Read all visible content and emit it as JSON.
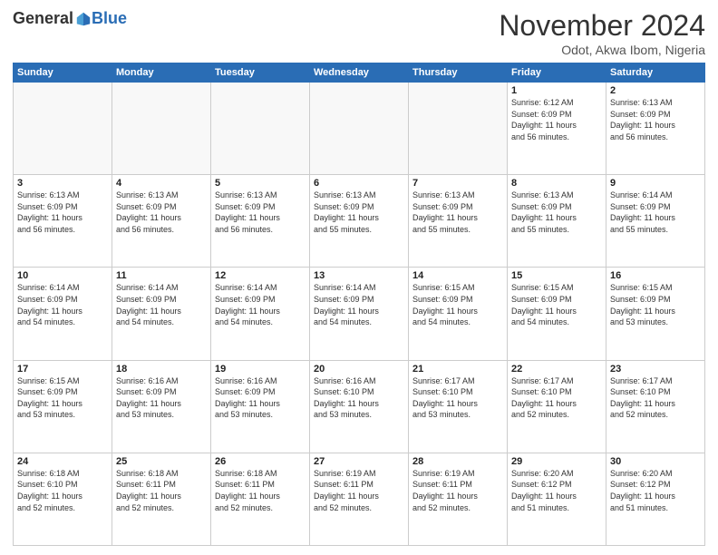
{
  "header": {
    "logo_general": "General",
    "logo_blue": "Blue",
    "month_title": "November 2024",
    "location": "Odot, Akwa Ibom, Nigeria"
  },
  "calendar": {
    "days_of_week": [
      "Sunday",
      "Monday",
      "Tuesday",
      "Wednesday",
      "Thursday",
      "Friday",
      "Saturday"
    ],
    "weeks": [
      [
        {
          "day": "",
          "info": ""
        },
        {
          "day": "",
          "info": ""
        },
        {
          "day": "",
          "info": ""
        },
        {
          "day": "",
          "info": ""
        },
        {
          "day": "",
          "info": ""
        },
        {
          "day": "1",
          "info": "Sunrise: 6:12 AM\nSunset: 6:09 PM\nDaylight: 11 hours\nand 56 minutes."
        },
        {
          "day": "2",
          "info": "Sunrise: 6:13 AM\nSunset: 6:09 PM\nDaylight: 11 hours\nand 56 minutes."
        }
      ],
      [
        {
          "day": "3",
          "info": "Sunrise: 6:13 AM\nSunset: 6:09 PM\nDaylight: 11 hours\nand 56 minutes."
        },
        {
          "day": "4",
          "info": "Sunrise: 6:13 AM\nSunset: 6:09 PM\nDaylight: 11 hours\nand 56 minutes."
        },
        {
          "day": "5",
          "info": "Sunrise: 6:13 AM\nSunset: 6:09 PM\nDaylight: 11 hours\nand 56 minutes."
        },
        {
          "day": "6",
          "info": "Sunrise: 6:13 AM\nSunset: 6:09 PM\nDaylight: 11 hours\nand 55 minutes."
        },
        {
          "day": "7",
          "info": "Sunrise: 6:13 AM\nSunset: 6:09 PM\nDaylight: 11 hours\nand 55 minutes."
        },
        {
          "day": "8",
          "info": "Sunrise: 6:13 AM\nSunset: 6:09 PM\nDaylight: 11 hours\nand 55 minutes."
        },
        {
          "day": "9",
          "info": "Sunrise: 6:14 AM\nSunset: 6:09 PM\nDaylight: 11 hours\nand 55 minutes."
        }
      ],
      [
        {
          "day": "10",
          "info": "Sunrise: 6:14 AM\nSunset: 6:09 PM\nDaylight: 11 hours\nand 54 minutes."
        },
        {
          "day": "11",
          "info": "Sunrise: 6:14 AM\nSunset: 6:09 PM\nDaylight: 11 hours\nand 54 minutes."
        },
        {
          "day": "12",
          "info": "Sunrise: 6:14 AM\nSunset: 6:09 PM\nDaylight: 11 hours\nand 54 minutes."
        },
        {
          "day": "13",
          "info": "Sunrise: 6:14 AM\nSunset: 6:09 PM\nDaylight: 11 hours\nand 54 minutes."
        },
        {
          "day": "14",
          "info": "Sunrise: 6:15 AM\nSunset: 6:09 PM\nDaylight: 11 hours\nand 54 minutes."
        },
        {
          "day": "15",
          "info": "Sunrise: 6:15 AM\nSunset: 6:09 PM\nDaylight: 11 hours\nand 54 minutes."
        },
        {
          "day": "16",
          "info": "Sunrise: 6:15 AM\nSunset: 6:09 PM\nDaylight: 11 hours\nand 53 minutes."
        }
      ],
      [
        {
          "day": "17",
          "info": "Sunrise: 6:15 AM\nSunset: 6:09 PM\nDaylight: 11 hours\nand 53 minutes."
        },
        {
          "day": "18",
          "info": "Sunrise: 6:16 AM\nSunset: 6:09 PM\nDaylight: 11 hours\nand 53 minutes."
        },
        {
          "day": "19",
          "info": "Sunrise: 6:16 AM\nSunset: 6:09 PM\nDaylight: 11 hours\nand 53 minutes."
        },
        {
          "day": "20",
          "info": "Sunrise: 6:16 AM\nSunset: 6:10 PM\nDaylight: 11 hours\nand 53 minutes."
        },
        {
          "day": "21",
          "info": "Sunrise: 6:17 AM\nSunset: 6:10 PM\nDaylight: 11 hours\nand 53 minutes."
        },
        {
          "day": "22",
          "info": "Sunrise: 6:17 AM\nSunset: 6:10 PM\nDaylight: 11 hours\nand 52 minutes."
        },
        {
          "day": "23",
          "info": "Sunrise: 6:17 AM\nSunset: 6:10 PM\nDaylight: 11 hours\nand 52 minutes."
        }
      ],
      [
        {
          "day": "24",
          "info": "Sunrise: 6:18 AM\nSunset: 6:10 PM\nDaylight: 11 hours\nand 52 minutes."
        },
        {
          "day": "25",
          "info": "Sunrise: 6:18 AM\nSunset: 6:11 PM\nDaylight: 11 hours\nand 52 minutes."
        },
        {
          "day": "26",
          "info": "Sunrise: 6:18 AM\nSunset: 6:11 PM\nDaylight: 11 hours\nand 52 minutes."
        },
        {
          "day": "27",
          "info": "Sunrise: 6:19 AM\nSunset: 6:11 PM\nDaylight: 11 hours\nand 52 minutes."
        },
        {
          "day": "28",
          "info": "Sunrise: 6:19 AM\nSunset: 6:11 PM\nDaylight: 11 hours\nand 52 minutes."
        },
        {
          "day": "29",
          "info": "Sunrise: 6:20 AM\nSunset: 6:12 PM\nDaylight: 11 hours\nand 51 minutes."
        },
        {
          "day": "30",
          "info": "Sunrise: 6:20 AM\nSunset: 6:12 PM\nDaylight: 11 hours\nand 51 minutes."
        }
      ]
    ]
  }
}
